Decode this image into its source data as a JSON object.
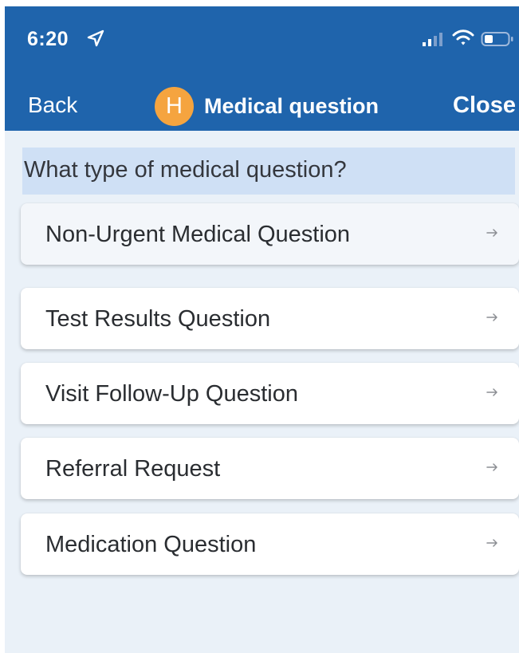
{
  "status_bar": {
    "time": "6:20",
    "icons": [
      "location-icon",
      "signal-icon",
      "wifi-icon",
      "battery-icon"
    ]
  },
  "nav": {
    "back_label": "Back",
    "avatar_initial": "H",
    "title": "Medical question",
    "close_label": "Close"
  },
  "question": {
    "title": "What type of medical question?"
  },
  "options": [
    {
      "label": "Non-Urgent Medical Question",
      "icon": "arrow-right-icon"
    },
    {
      "label": "Test Results Question",
      "icon": "arrow-right-icon"
    },
    {
      "label": "Visit Follow-Up Question",
      "icon": "arrow-right-icon"
    },
    {
      "label": "Referral Request",
      "icon": "arrow-right-icon"
    },
    {
      "label": "Medication Question",
      "icon": "arrow-right-icon"
    }
  ],
  "colors": {
    "header": "#1f64ac",
    "avatar": "#f5a43f",
    "question_bar": "#cfe0f5",
    "background": "#eaf1f8",
    "card": "#ffffff",
    "text": "#2a2d31"
  }
}
